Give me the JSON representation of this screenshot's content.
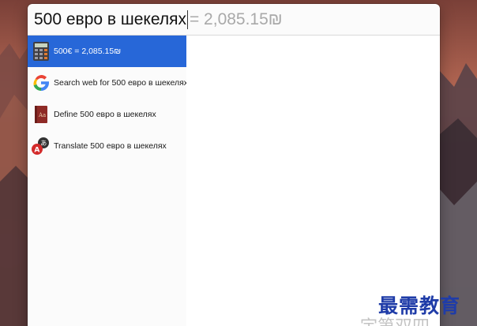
{
  "search": {
    "query": "500 евро в шекелях",
    "inline_result": "= 2,085.15₪"
  },
  "results": [
    {
      "label": "500€ = 2,085.15₪",
      "icon": "calculator-icon",
      "selected": true
    },
    {
      "label": "Search web for 500 евро в шекелях",
      "icon": "google-icon",
      "selected": false
    },
    {
      "label": "Define 500 евро в шекелях",
      "icon": "dictionary-icon",
      "selected": false
    },
    {
      "label": "Translate 500 евро в шекелях",
      "icon": "translate-icon",
      "selected": false
    }
  ],
  "watermark": {
    "text": "最需教育",
    "partial_text": "宇第双四"
  },
  "colors": {
    "selection": "#2767d8",
    "google_blue": "#4285f4",
    "google_red": "#ea4335",
    "google_yellow": "#fbbc05",
    "google_green": "#34a853",
    "watermark": "#1f3ca8"
  }
}
